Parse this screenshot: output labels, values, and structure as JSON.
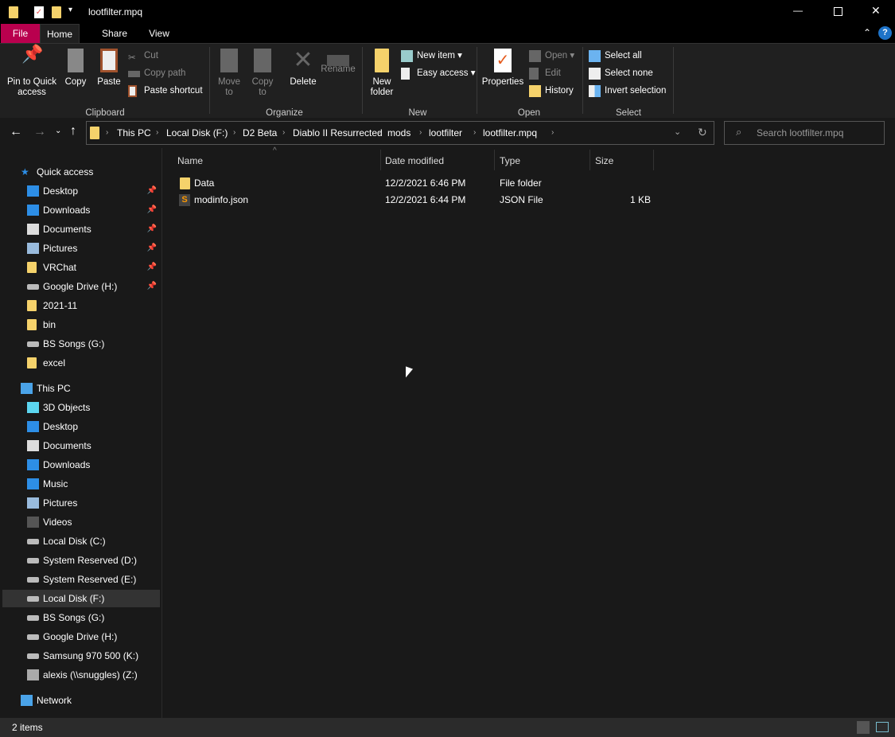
{
  "window": {
    "title": "lootfilter.mpq",
    "minimize": "—",
    "maximize": "☐",
    "close": "✕"
  },
  "tabs": [
    {
      "label": "File",
      "color": "#b9004e"
    },
    {
      "label": "Home"
    },
    {
      "label": "Share"
    },
    {
      "label": "View"
    }
  ],
  "ribbon": {
    "clipboard": {
      "group": "Clipboard",
      "pin": "Pin to Quick access",
      "copy": "Copy",
      "paste": "Paste",
      "cut": "Cut",
      "copy_path": "Copy path",
      "paste_shortcut": "Paste shortcut"
    },
    "organize": {
      "group": "Organize",
      "move_to": "Move to",
      "copy_to": "Copy to",
      "delete": "Delete",
      "rename": "Rename"
    },
    "new": {
      "group": "New",
      "new_folder": "New folder",
      "new_item": "New item",
      "easy_access": "Easy access"
    },
    "open": {
      "group": "Open",
      "properties": "Properties",
      "open": "Open",
      "edit": "Edit",
      "history": "History"
    },
    "select": {
      "group": "Select",
      "select_all": "Select all",
      "select_none": "Select none",
      "invert": "Invert selection"
    }
  },
  "address": {
    "crumbs": [
      "This PC",
      "Local Disk (F:)",
      "D2 Beta",
      "Diablo II Resurrected",
      "mods",
      "lootfilter",
      "lootfilter.mpq"
    ],
    "search_placeholder": "Search lootfilter.mpq"
  },
  "sidebar": {
    "quick_access": "Quick access",
    "quick": [
      {
        "label": "Desktop",
        "pinned": true
      },
      {
        "label": "Downloads",
        "pinned": true
      },
      {
        "label": "Documents",
        "pinned": true
      },
      {
        "label": "Pictures",
        "pinned": true
      },
      {
        "label": "VRChat",
        "pinned": true
      },
      {
        "label": "Google Drive (H:)",
        "pinned": true
      },
      {
        "label": "2021-11"
      },
      {
        "label": "bin"
      },
      {
        "label": "BS Songs (G:)"
      },
      {
        "label": "excel"
      }
    ],
    "this_pc": "This PC",
    "pc": [
      {
        "label": "3D Objects"
      },
      {
        "label": "Desktop"
      },
      {
        "label": "Documents"
      },
      {
        "label": "Downloads"
      },
      {
        "label": "Music"
      },
      {
        "label": "Pictures"
      },
      {
        "label": "Videos"
      },
      {
        "label": "Local Disk (C:)"
      },
      {
        "label": "System Reserved (D:)"
      },
      {
        "label": "System Reserved (E:)"
      },
      {
        "label": "Local Disk (F:)",
        "selected": true
      },
      {
        "label": "BS Songs (G:)"
      },
      {
        "label": "Google Drive (H:)"
      },
      {
        "label": "Samsung 970 500 (K:)"
      },
      {
        "label": "alexis (\\\\snuggles) (Z:)"
      }
    ],
    "network": "Network"
  },
  "columns": [
    "Name",
    "Date modified",
    "Type",
    "Size"
  ],
  "files": [
    {
      "name": "Data",
      "date": "12/2/2021 6:46 PM",
      "type": "File folder",
      "size": "",
      "icon": "folder-icon"
    },
    {
      "name": "modinfo.json",
      "date": "12/2/2021 6:44 PM",
      "type": "JSON File",
      "size": "1 KB",
      "icon": "sublime-file-icon"
    }
  ],
  "status": {
    "items": "2 items"
  }
}
